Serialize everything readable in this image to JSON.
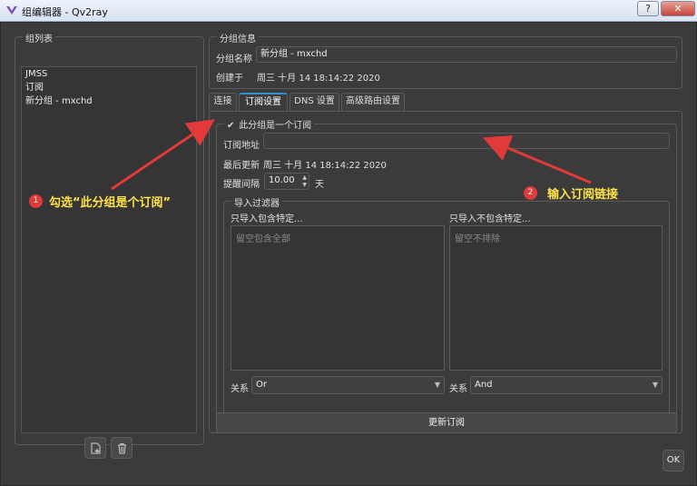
{
  "window": {
    "title": "组编辑器 - Qv2ray",
    "help_label": "?",
    "close_label": "✕"
  },
  "colors": {
    "accent_tab": "#2f8fcf",
    "annotation_red": "#e03a3a",
    "annotation_text": "#ffe24a"
  },
  "group_list": {
    "title": "组列表",
    "items": [
      "JMSS",
      "订阅",
      "新分组 - mxchd"
    ],
    "add_icon": "add-file-icon",
    "delete_icon": "trash-icon"
  },
  "group_info": {
    "title": "分组信息",
    "name_label": "分组名称",
    "name_value": "新分组 - mxchd",
    "created_label": "创建于",
    "created_value": "周三 十月 14 18:14:22 2020"
  },
  "tabs": [
    {
      "label": "连接",
      "active": false
    },
    {
      "label": "订阅设置",
      "active": true
    },
    {
      "label": "DNS 设置",
      "active": false
    },
    {
      "label": "高级路由设置",
      "active": false
    }
  ],
  "subscription": {
    "checkbox_label": "此分组是一个订阅",
    "checked": true,
    "url_label": "订阅地址",
    "url_value": "",
    "last_update_label": "最后更新",
    "last_update_value": "周三 十月 14 18:14:22 2020",
    "interval_label": "提醒间隔",
    "interval_value": "10.00",
    "interval_unit": "天",
    "filter": {
      "title": "导入过滤器",
      "include_label": "只导入包含特定...",
      "include_placeholder": "留空包含全部",
      "exclude_label": "只导入不包含特定...",
      "exclude_placeholder": "留空不排除",
      "relation_label": "关系",
      "include_relation": "Or",
      "exclude_relation": "And"
    },
    "update_button": "更新订阅"
  },
  "ok_button": "OK",
  "annotations": [
    {
      "number": "1",
      "text": "勾选“此分组是个订阅”"
    },
    {
      "number": "2",
      "text": "输入订阅链接"
    }
  ]
}
